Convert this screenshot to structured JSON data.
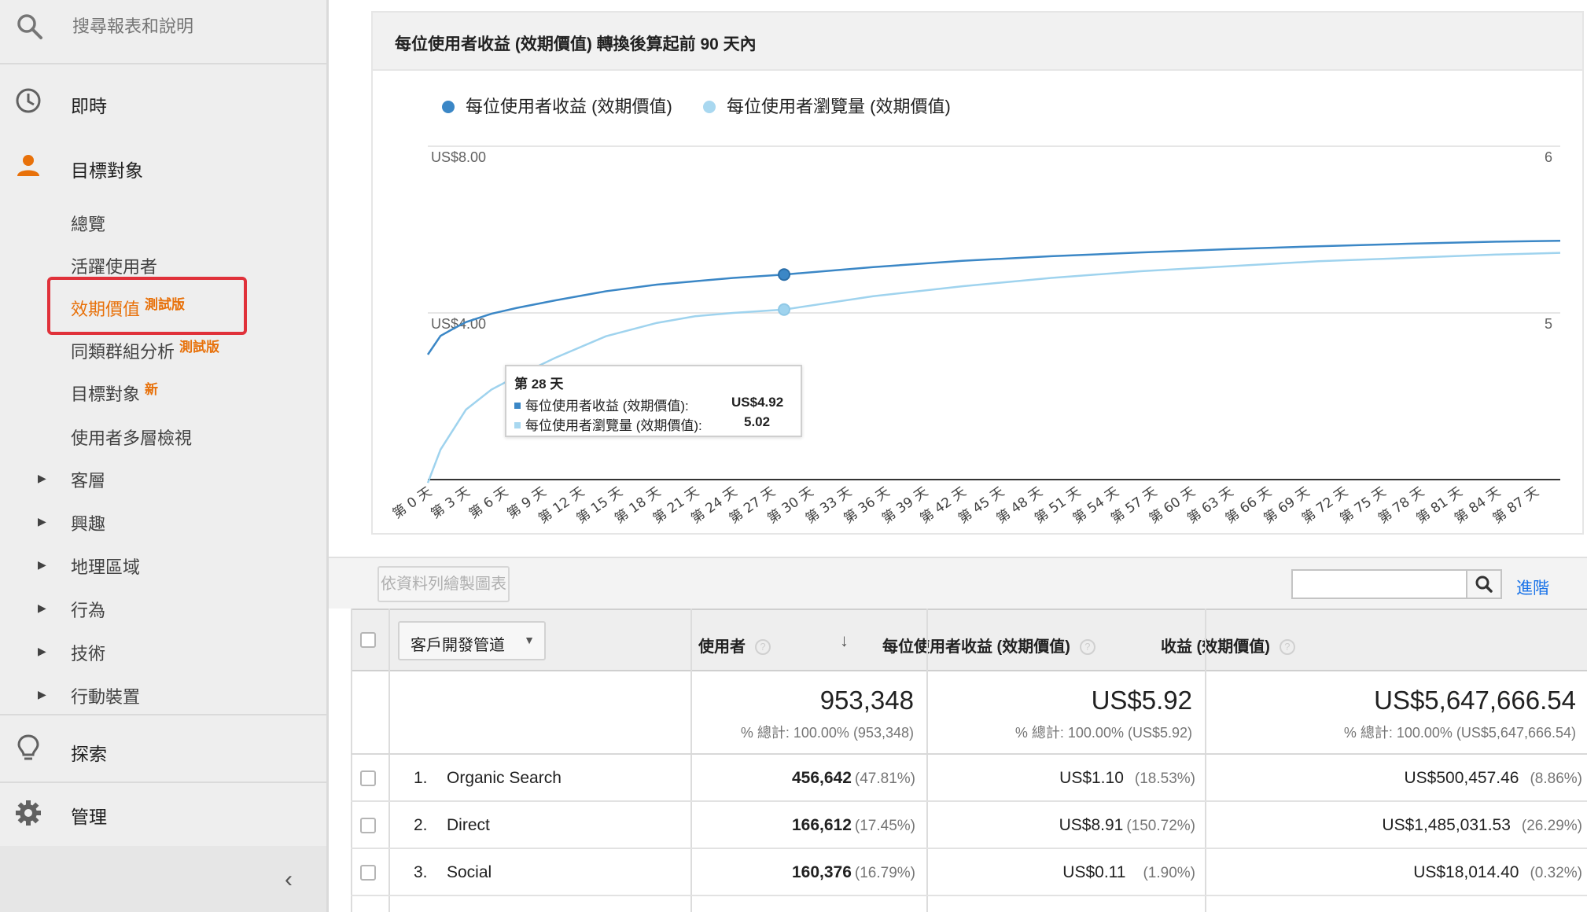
{
  "sidebar": {
    "search_placeholder": "搜尋報表和說明",
    "realtime": "即時",
    "audience": "目標對象",
    "sub": {
      "overview": "總覽",
      "active_users": "活躍使用者",
      "lifetime_value": "效期價值",
      "lifetime_badge": "測試版",
      "cohort": "同類群組分析",
      "cohort_badge": "測試版",
      "audiences": "目標對象",
      "audiences_badge": "新",
      "user_explorer": "使用者多層檢視",
      "demographics": "客層",
      "interests": "興趣",
      "geo": "地理區域",
      "behavior": "行為",
      "technology": "技術",
      "mobile": "行動裝置"
    },
    "discover": "探索",
    "admin": "管理"
  },
  "chart_card": {
    "title": "每位使用者收益 (效期價值) 轉換後算起前 90 天內"
  },
  "chart_data": {
    "type": "line",
    "series": [
      {
        "name": "每位使用者收益 (效期價值)",
        "color": "#3b87c6",
        "axis": "left",
        "x_days": [
          0,
          1,
          2,
          3,
          5,
          7,
          10,
          14,
          18,
          21,
          24,
          28,
          35,
          42,
          49,
          56,
          63,
          70,
          77,
          84,
          89
        ],
        "values": [
          3.0,
          3.45,
          3.62,
          3.78,
          3.98,
          4.12,
          4.3,
          4.52,
          4.68,
          4.76,
          4.84,
          4.92,
          5.1,
          5.25,
          5.36,
          5.45,
          5.53,
          5.6,
          5.66,
          5.71,
          5.73
        ]
      },
      {
        "name": "每位使用者瀏覽量 (效期價值)",
        "color": "#9fd3ee",
        "axis": "right",
        "x_days": [
          0,
          1,
          2,
          3,
          5,
          7,
          10,
          14,
          18,
          21,
          24,
          28,
          35,
          42,
          49,
          56,
          63,
          70,
          77,
          84,
          89
        ],
        "values": [
          3.98,
          4.18,
          4.3,
          4.42,
          4.54,
          4.62,
          4.73,
          4.86,
          4.94,
          4.98,
          5.0,
          5.02,
          5.1,
          5.16,
          5.21,
          5.25,
          5.28,
          5.31,
          5.33,
          5.35,
          5.36
        ]
      }
    ],
    "y_left_ticks": [
      "US$8.00",
      "US$4.00"
    ],
    "y_right_ticks": [
      "6",
      "5"
    ],
    "y_left_range": [
      0,
      8
    ],
    "y_right_range": [
      4,
      6
    ],
    "x_ticks": [
      "第 0 天",
      "第 3 天",
      "第 6 天",
      "第 9 天",
      "第 12 天",
      "第 15 天",
      "第 18 天",
      "第 21 天",
      "第 24 天",
      "第 27 天",
      "第 30 天",
      "第 33 天",
      "第 36 天",
      "第 39 天",
      "第 42 天",
      "第 45 天",
      "第 48 天",
      "第 51 天",
      "第 54 天",
      "第 57 天",
      "第 60 天",
      "第 63 天",
      "第 66 天",
      "第 69 天",
      "第 72 天",
      "第 75 天",
      "第 78 天",
      "第 81 天",
      "第 84 天",
      "第 87 天"
    ],
    "highlight_day": 28,
    "tooltip": {
      "title": "第 28 天",
      "rows": [
        {
          "label": "每位使用者收益 (效期價值):",
          "value": "US$4.92"
        },
        {
          "label": "每位使用者瀏覽量 (效期價值):",
          "value": "5.02"
        }
      ]
    }
  },
  "toolbar": {
    "plot_rows": "依資料列繪製圖表",
    "advanced": "進階"
  },
  "table": {
    "dimension": "客戶開發管道",
    "headers": {
      "users": "使用者",
      "rev_per_user": "每位使用者收益 (效期價值)",
      "revenue": "收益 (效期價值)",
      "help": "?"
    },
    "totals": {
      "users": "953,348",
      "users_sub": "% 總計: 100.00% (953,348)",
      "rev_per_user": "US$5.92",
      "rev_per_user_sub": "% 總計: 100.00% (US$5.92)",
      "revenue": "US$5,647,666.54",
      "revenue_sub": "% 總計: 100.00% (US$5,647,666.54)"
    },
    "rows": [
      {
        "num": "1.",
        "channel": "Organic Search",
        "users": "456,642",
        "users_pct": "(47.81%)",
        "rpu": "US$1.10",
        "rpu_pct": "(18.53%)",
        "rev": "US$500,457.46",
        "rev_pct": "(8.86%)"
      },
      {
        "num": "2.",
        "channel": "Direct",
        "users": "166,612",
        "users_pct": "(17.45%)",
        "rpu": "US$8.91",
        "rpu_pct": "(150.72%)",
        "rev": "US$1,485,031.53",
        "rev_pct": "(26.29%)"
      },
      {
        "num": "3.",
        "channel": "Social",
        "users": "160,376",
        "users_pct": "(16.79%)",
        "rpu": "US$0.11",
        "rpu_pct": "(1.90%)",
        "rev": "US$18,014.40",
        "rev_pct": "(0.32%)"
      }
    ]
  }
}
